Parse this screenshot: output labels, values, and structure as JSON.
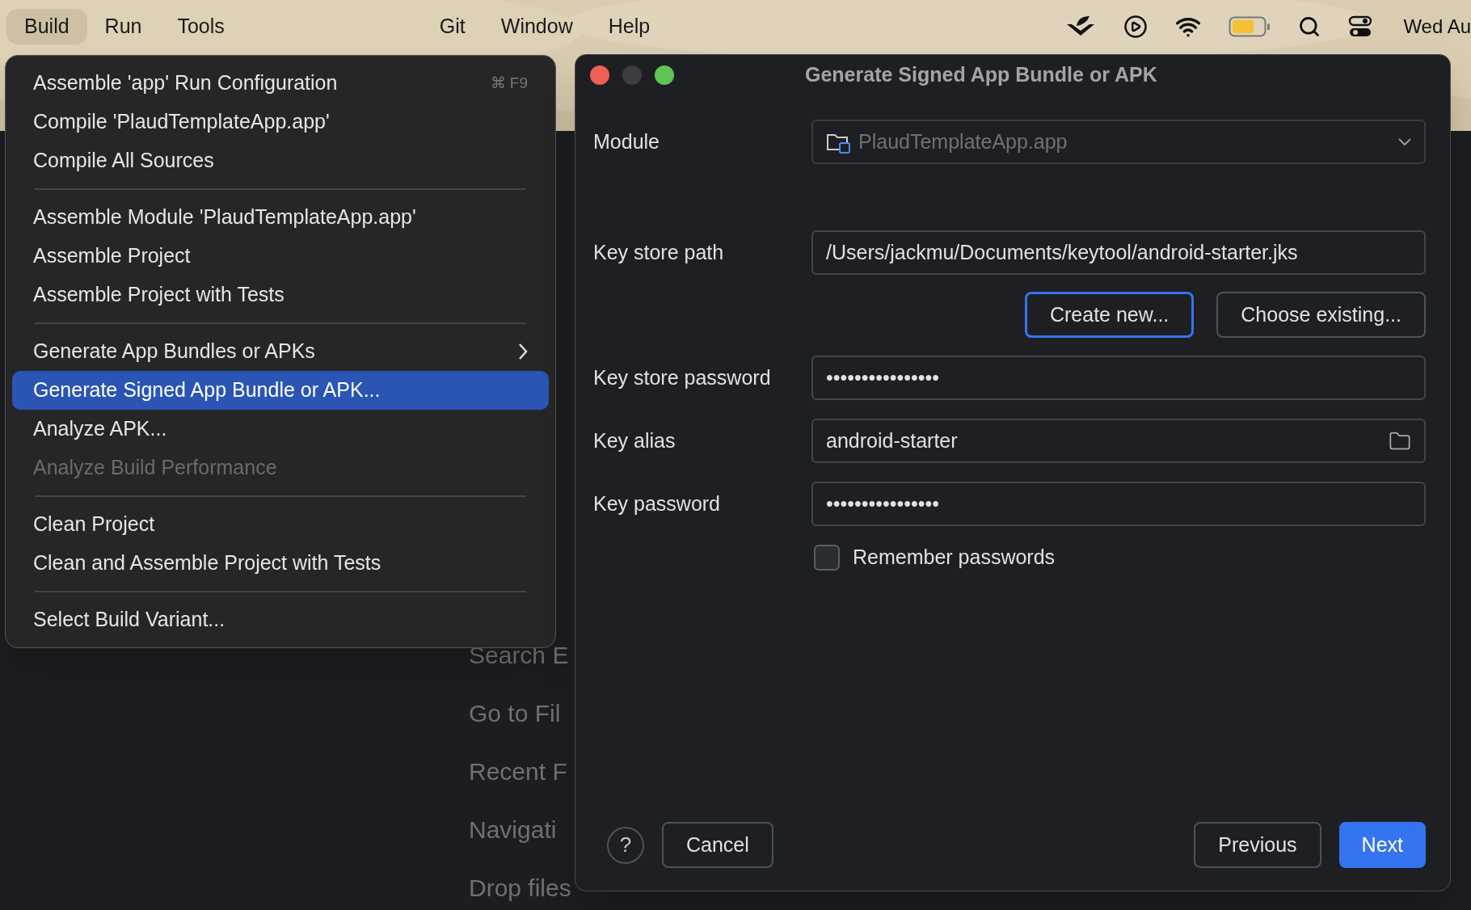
{
  "menu_bar": {
    "items": [
      {
        "label": "Build",
        "selected": true
      },
      {
        "label": "Run",
        "selected": false
      },
      {
        "label": "Tools",
        "selected": false
      },
      {
        "label": "Git",
        "selected": false
      },
      {
        "label": "Window",
        "selected": false
      },
      {
        "label": "Help",
        "selected": false
      }
    ],
    "clock": "Wed Au"
  },
  "background_ide": {
    "welcome_items": [
      "Search E",
      "Go to Fil",
      "Recent F",
      "Navigati",
      "Drop files"
    ]
  },
  "build_menu": {
    "groups": [
      {
        "items": [
          {
            "label": "Assemble 'app' Run Configuration",
            "shortcut": "⌘ F9",
            "selected": false,
            "disabled": false
          },
          {
            "label": "Compile 'PlaudTemplateApp.app'",
            "selected": false,
            "disabled": false
          },
          {
            "label": "Compile All Sources",
            "selected": false,
            "disabled": false
          }
        ]
      },
      {
        "items": [
          {
            "label": "Assemble Module 'PlaudTemplateApp.app'",
            "selected": false,
            "disabled": false
          },
          {
            "label": "Assemble Project",
            "selected": false,
            "disabled": false
          },
          {
            "label": "Assemble Project with Tests",
            "selected": false,
            "disabled": false
          }
        ]
      },
      {
        "items": [
          {
            "label": "Generate App Bundles or APKs",
            "submenu": true,
            "selected": false,
            "disabled": false
          },
          {
            "label": "Generate Signed App Bundle or APK...",
            "selected": true,
            "disabled": false
          },
          {
            "label": "Analyze APK...",
            "selected": false,
            "disabled": false
          },
          {
            "label": "Analyze Build Performance",
            "selected": false,
            "disabled": true
          }
        ]
      },
      {
        "items": [
          {
            "label": "Clean Project",
            "selected": false,
            "disabled": false
          },
          {
            "label": "Clean and Assemble Project with Tests",
            "selected": false,
            "disabled": false
          }
        ]
      },
      {
        "items": [
          {
            "label": "Select Build Variant...",
            "selected": false,
            "disabled": false
          }
        ]
      }
    ]
  },
  "dialog": {
    "title": "Generate Signed App Bundle or APK",
    "module": {
      "label": "Module",
      "value": "PlaudTemplateApp.app"
    },
    "key_store_path": {
      "label": "Key store path",
      "value": "/Users/jackmu/Documents/keytool/android-starter.jks"
    },
    "key_store_buttons": [
      {
        "label": "Create new...",
        "focused": true
      },
      {
        "label": "Choose existing...",
        "focused": false
      }
    ],
    "key_store_password": {
      "label": "Key store password",
      "value": "••••••••••••••••"
    },
    "key_alias": {
      "label": "Key alias",
      "value": "android-starter"
    },
    "key_password": {
      "label": "Key password",
      "value": "••••••••••••••••"
    },
    "remember_passwords": {
      "label": "Remember passwords",
      "checked": false
    },
    "help": "?",
    "footer_left_buttons": [
      {
        "label": "Cancel"
      }
    ],
    "footer_right_buttons": [
      {
        "label": "Previous",
        "kind": "default"
      },
      {
        "label": "Next",
        "kind": "primary"
      }
    ]
  }
}
